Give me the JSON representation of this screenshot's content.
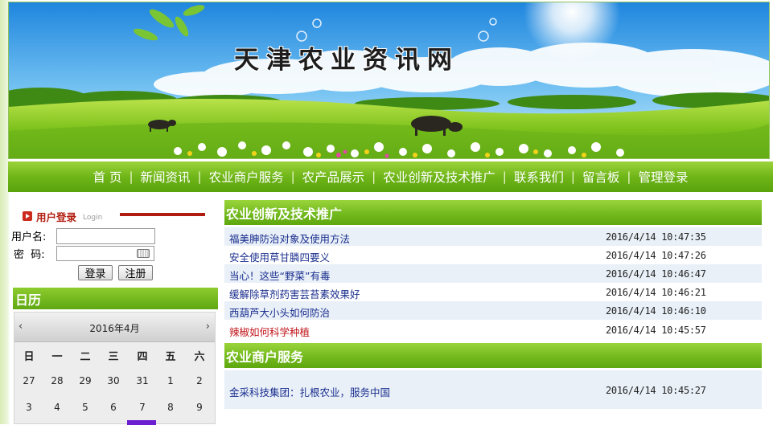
{
  "banner": {
    "title": "天津农业资讯网"
  },
  "nav": {
    "items": [
      "首 页",
      "新闻资讯",
      "农业商户服务",
      "农产品展示",
      "农业创新及技术推广",
      "联系我们",
      "留言板",
      "管理登录"
    ],
    "separator": "|"
  },
  "login": {
    "title": "用户登录",
    "subtitle": "Login",
    "username_label": "用户名:",
    "password_label": "密  码:",
    "username_value": "",
    "password_value": "",
    "login_button": "登录",
    "register_button": "注册"
  },
  "calendar": {
    "title": "日历",
    "month_label": "2016年4月",
    "prev_symbol": "‹",
    "next_symbol": "›",
    "weekdays": [
      "日",
      "一",
      "二",
      "三",
      "四",
      "五",
      "六"
    ],
    "week1": [
      "27",
      "28",
      "29",
      "30",
      "31",
      "1",
      "2"
    ],
    "week2": [
      "3",
      "4",
      "5",
      "6",
      "7",
      "8",
      "9"
    ]
  },
  "tech_section": {
    "title": "农业创新及技术推广",
    "items": [
      {
        "title": "福美胂防治对象及使用方法",
        "date": "2016/4/14  10:47:35"
      },
      {
        "title": "安全使用草甘膦四要义",
        "date": "2016/4/14  10:47:26"
      },
      {
        "title": "当心！这些“野菜”有毒",
        "date": "2016/4/14  10:46:47"
      },
      {
        "title": "缓解除草剂药害芸苔素效果好",
        "date": "2016/4/14  10:46:21"
      },
      {
        "title": "西葫芦大小头如何防治",
        "date": "2016/4/14  10:46:10"
      },
      {
        "title": "辣椒如何科学种植",
        "date": "2016/4/14  10:45:57"
      }
    ]
  },
  "biz_section": {
    "title": "农业商户服务",
    "items": [
      {
        "title": "金采科技集团：扎根农业，服务中国",
        "date": "2016/4/14  10:45:27"
      }
    ]
  },
  "colors": {
    "nav_green": "#6fb619",
    "link_blue": "#1b2f8e",
    "highlight_red": "#c0141a",
    "login_red": "#b21d10",
    "calendar_today": "#6b1fd0"
  }
}
